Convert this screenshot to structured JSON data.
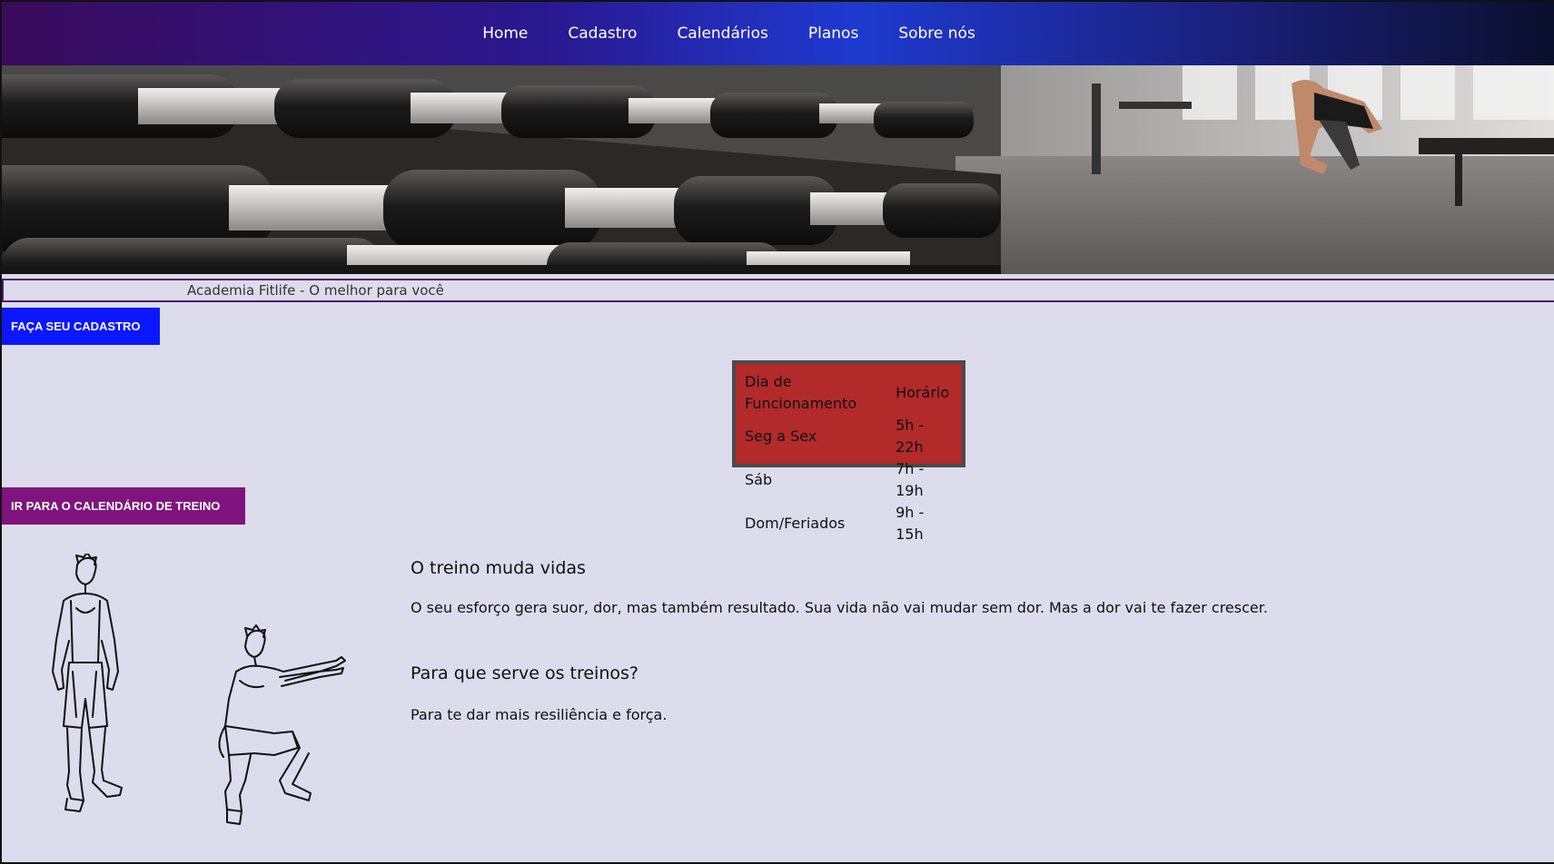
{
  "nav": {
    "items": [
      {
        "label": "Home"
      },
      {
        "label": "Cadastro"
      },
      {
        "label": "Calendários"
      },
      {
        "label": "Planos"
      },
      {
        "label": "Sobre nós"
      }
    ]
  },
  "hero": {
    "image": "gym-dumbbells-photo"
  },
  "marquee": {
    "text": "Academia Fitlife - O melhor para você"
  },
  "buttons": {
    "cadastro": "FAÇA SEU CADASTRO",
    "calendario": "IR PARA O CALENDÁRIO DE TREINO"
  },
  "hours": {
    "headers": [
      "Dia de Funcionamento",
      "Horário"
    ],
    "rows": [
      [
        "Seg a Sex",
        "5h - 22h"
      ],
      [
        "Sáb",
        "7h - 19h"
      ],
      [
        "Dom/Feriados",
        "9h - 15h"
      ]
    ]
  },
  "content": {
    "heading1": "O treino muda vidas",
    "paragraph1": "O seu esforço gera suor, dor, mas também resultado. Sua vida não vai mudar sem dor. Mas a dor vai te fazer crescer.",
    "heading2": "Para que serve os treinos?",
    "paragraph2": "Para te dar mais resiliência e força."
  },
  "colors": {
    "nav_gradient_start": "#3a0b5c",
    "nav_gradient_mid": "#1e3ad0",
    "nav_gradient_end": "#0a0f2e",
    "cadastro_button": "#0b17ff",
    "calendario_button": "#80147e",
    "hours_box_bg": "#b22a2a",
    "page_bg": "#dcdcec"
  }
}
